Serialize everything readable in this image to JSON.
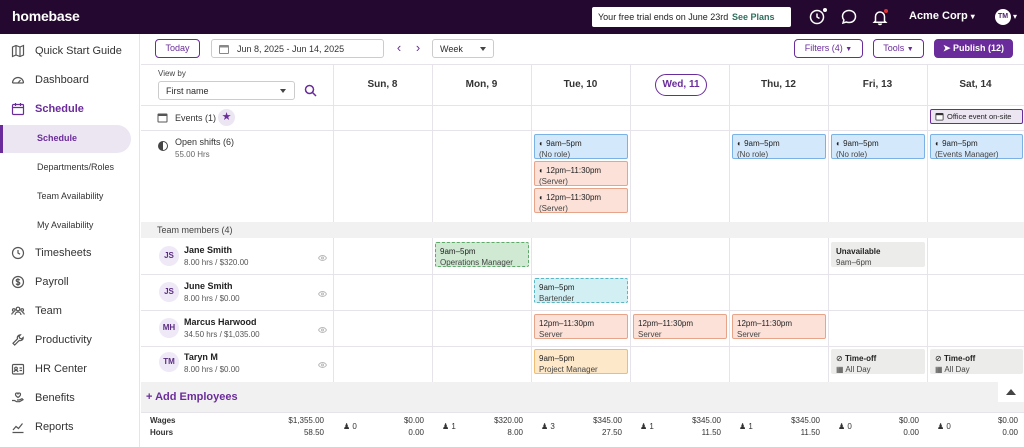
{
  "topbar": {
    "logo": "homebase",
    "trial_text": "Your free trial ends on June 23rd",
    "see_plans": "See Plans",
    "company": "Acme Corp",
    "avatar_initials": "TM",
    "dot_colors": {
      "clock": "#ffffff",
      "bell": "#e03131"
    }
  },
  "sidebar": {
    "items": [
      {
        "label": "Quick Start Guide",
        "icon": "map-icon"
      },
      {
        "label": "Dashboard",
        "icon": "gauge-icon"
      },
      {
        "label": "Schedule",
        "icon": "calendar-icon"
      },
      {
        "label": "Timesheets",
        "icon": "clock-icon"
      },
      {
        "label": "Payroll",
        "icon": "dollar-icon"
      },
      {
        "label": "Team",
        "icon": "team-icon"
      },
      {
        "label": "Productivity",
        "icon": "wrench-icon"
      },
      {
        "label": "HR Center",
        "icon": "id-card-icon"
      },
      {
        "label": "Benefits",
        "icon": "hand-heart-icon"
      },
      {
        "label": "Reports",
        "icon": "chart-icon"
      }
    ],
    "schedule_sub": [
      {
        "label": "Schedule"
      },
      {
        "label": "Departments/Roles"
      },
      {
        "label": "Team Availability"
      },
      {
        "label": "My Availability"
      }
    ]
  },
  "toolbar": {
    "today": "Today",
    "date_range": "Jun 8, 2025 - Jun 14, 2025",
    "view_mode": "Week",
    "filters": "Filters (4)",
    "tools": "Tools",
    "publish": "Publish (12)"
  },
  "viewby": {
    "label": "View by",
    "value": "First name"
  },
  "days": [
    "Sun, 8",
    "Mon, 9",
    "Tue, 10",
    "Wed, 11",
    "Thu, 12",
    "Fri, 13",
    "Sat, 14"
  ],
  "events_row": {
    "label": "Events (1)",
    "event": "Office event on-site"
  },
  "open_shifts": {
    "label": "Open shifts (6)",
    "hours": "55.00 Hrs"
  },
  "team_section": "Team members (4)",
  "employees": [
    {
      "initials": "JS",
      "name": "Jane Smith",
      "sub": "8.00 hrs / $320.00"
    },
    {
      "initials": "JS",
      "name": "June Smith",
      "sub": "8.00 hrs / $0.00"
    },
    {
      "initials": "MH",
      "name": "Marcus Harwood",
      "sub": "34.50 hrs / $1,035.00"
    },
    {
      "initials": "TM",
      "name": "Taryn M",
      "sub": "8.00 hrs / $0.00"
    }
  ],
  "shifts": {
    "open_tue_1": {
      "time": "9am–5pm",
      "role": "(No role)"
    },
    "open_tue_2": {
      "time": "12pm–11:30pm",
      "role": "(Server)"
    },
    "open_tue_3": {
      "time": "12pm–11:30pm",
      "role": "(Server)"
    },
    "open_thu": {
      "time": "9am–5pm",
      "role": "(No role)"
    },
    "open_fri": {
      "time": "9am–5pm",
      "role": "(No role)"
    },
    "open_sat": {
      "time": "9am–5pm",
      "role": "(Events Manager)"
    },
    "jane_mon": {
      "time": "9am–5pm",
      "role": "Operations Manager"
    },
    "jane_fri": {
      "time": "Unavailable",
      "role": "9am–6pm"
    },
    "june_tue": {
      "time": "9am–5pm",
      "role": "Bartender"
    },
    "marcus_tue": {
      "time": "12pm–11:30pm",
      "role": "Server"
    },
    "marcus_wed": {
      "time": "12pm–11:30pm",
      "role": "Server"
    },
    "marcus_thu": {
      "time": "12pm–11:30pm",
      "role": "Server"
    },
    "taryn_tue": {
      "time": "9am–5pm",
      "role": "Project Manager"
    },
    "taryn_fri": {
      "time": "Time-off",
      "role": "All Day"
    },
    "taryn_sat": {
      "time": "Time-off",
      "role": "All Day"
    }
  },
  "add_employees": "+ Add Employees",
  "footer": {
    "wages_label": "Wages",
    "hours_label": "Hours",
    "total_wages": "$1,355.00",
    "total_hours": "58.50",
    "days": [
      {
        "count": "0",
        "wages": "$0.00",
        "hours": "0.00"
      },
      {
        "count": "1",
        "wages": "$320.00",
        "hours": "8.00"
      },
      {
        "count": "3",
        "wages": "$345.00",
        "hours": "27.50"
      },
      {
        "count": "1",
        "wages": "$345.00",
        "hours": "11.50"
      },
      {
        "count": "1",
        "wages": "$345.00",
        "hours": "11.50"
      },
      {
        "count": "0",
        "wages": "$0.00",
        "hours": "0.00"
      },
      {
        "count": "0",
        "wages": "$0.00",
        "hours": "0.00"
      }
    ]
  }
}
